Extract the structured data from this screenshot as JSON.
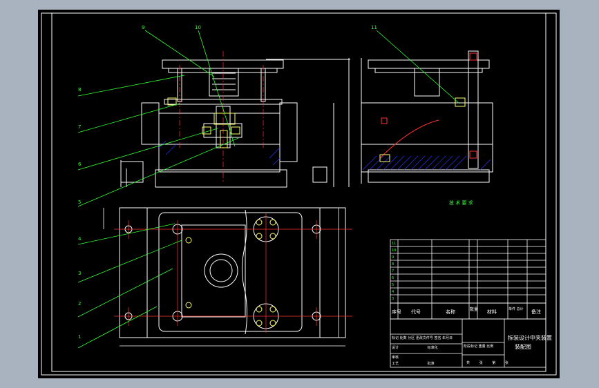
{
  "drawing": {
    "title_line1": "拆装设计中夹装置",
    "title_line2": "装配图",
    "balloons_front": [
      "9",
      "10"
    ],
    "balloons_side": [
      "11"
    ],
    "balloons_left": [
      "8",
      "7",
      "6",
      "5",
      "4",
      "3",
      "2",
      "1"
    ],
    "notes_title": "技 术 要 求"
  },
  "bom_header": {
    "seq": "序号",
    "code": "代号",
    "name": "名称",
    "qty": "数量",
    "material": "材料",
    "weight": "单件 总计",
    "remark": "备注"
  },
  "title_block": {
    "row1": [
      "标记",
      "处数",
      "分区",
      "更改文件号",
      "签名",
      "年月日"
    ],
    "row2": [
      "设计",
      "标准化"
    ],
    "row3": [
      "审核"
    ],
    "row4": [
      "工艺",
      "批准"
    ],
    "stage": [
      "阶段标记",
      "重量",
      "比例"
    ],
    "sheet": [
      "共",
      "张",
      "第",
      "张"
    ]
  },
  "colors": {
    "background": "#a8b3bf",
    "sheet": "#000000",
    "lines": "#ffffff",
    "centerline": "#ff3333",
    "hatch": "#3333ff",
    "leader": "#33ff33",
    "highlight": "#ffff66"
  }
}
